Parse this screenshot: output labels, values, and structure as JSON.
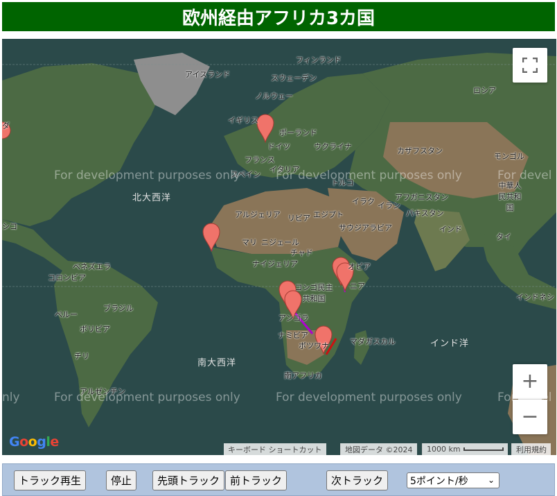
{
  "header": {
    "title": "欧州経由アフリカ3カ国"
  },
  "map": {
    "watermark": "For development purposes only",
    "watermark_cut": "For devel",
    "watermark_cut_left": "nly",
    "ocean_labels": {
      "north_atlantic": "北大西洋",
      "south_atlantic": "南大西洋",
      "indian_ocean": "インド洋"
    },
    "country_labels": {
      "finland": "フィンランド",
      "iceland": "アイスランド",
      "sweden": "スウェーデン",
      "norway": "ノルウェー",
      "russia": "ロシア",
      "uk": "イギリス",
      "poland": "ポーランド",
      "germany": "ドイツ",
      "ukraine": "ウクライナ",
      "kazakhstan": "カザフスタン",
      "mongolia": "モンゴル",
      "france": "フランス",
      "italy": "イタリア",
      "spain": "スペイン",
      "turkey": "トルコ",
      "china": "中華人民共和国",
      "algeria": "アルジェリア",
      "libya": "リビア",
      "egypt": "エジプト",
      "iraq": "イラク",
      "iran": "イラン",
      "afghanistan": "アフガニスタン",
      "pakistan": "パキスタン",
      "saudi": "サウジアラビア",
      "india": "インド",
      "thailand": "タイ",
      "mali": "マリ",
      "niger": "ニジェール",
      "chad": "チャド",
      "nigeria": "ナイジェリア",
      "ethiopia": "オピア",
      "drc": "コンゴ民主共和国",
      "angola": "アンゴラ",
      "kenya": "ニア",
      "namibia": "ナミビア",
      "botswana": "ボツワナ",
      "madagascar": "マダガスカル",
      "south_africa": "南アフリカ",
      "venezuela": "ベネズエラ",
      "colombia": "コロンビア",
      "brazil": "ブラジル",
      "peru": "ペルー",
      "bolivia": "ボリビア",
      "chile": "チリ",
      "argentina": "アルゼンチン",
      "indonesia": "インドネシ",
      "mexico": "シコ",
      "ka": "ダ"
    },
    "controls": {
      "fullscreen_icon": "fullscreen-icon",
      "zoom_in": "+",
      "zoom_out": "−"
    },
    "attribution": {
      "google_logo": "Google",
      "shortcuts": "キーボード ショートカット",
      "map_data": "地図データ ©2024",
      "scale": "1000 km",
      "terms": "利用規約"
    },
    "colors": {
      "ocean": "#2b4a4a",
      "land_green": "#4c6a44",
      "land_desert": "#8a7558",
      "marker": "#f0736a",
      "track_purple": "#b000d0",
      "track_red": "#cc1111"
    }
  },
  "toolbar": {
    "play_label": "トラック再生",
    "stop_label": "停止",
    "first_label": "先頭トラック",
    "prev_label": "前トラック",
    "next_label": "次トラック",
    "speed_selected": "5ポイント/秒"
  }
}
